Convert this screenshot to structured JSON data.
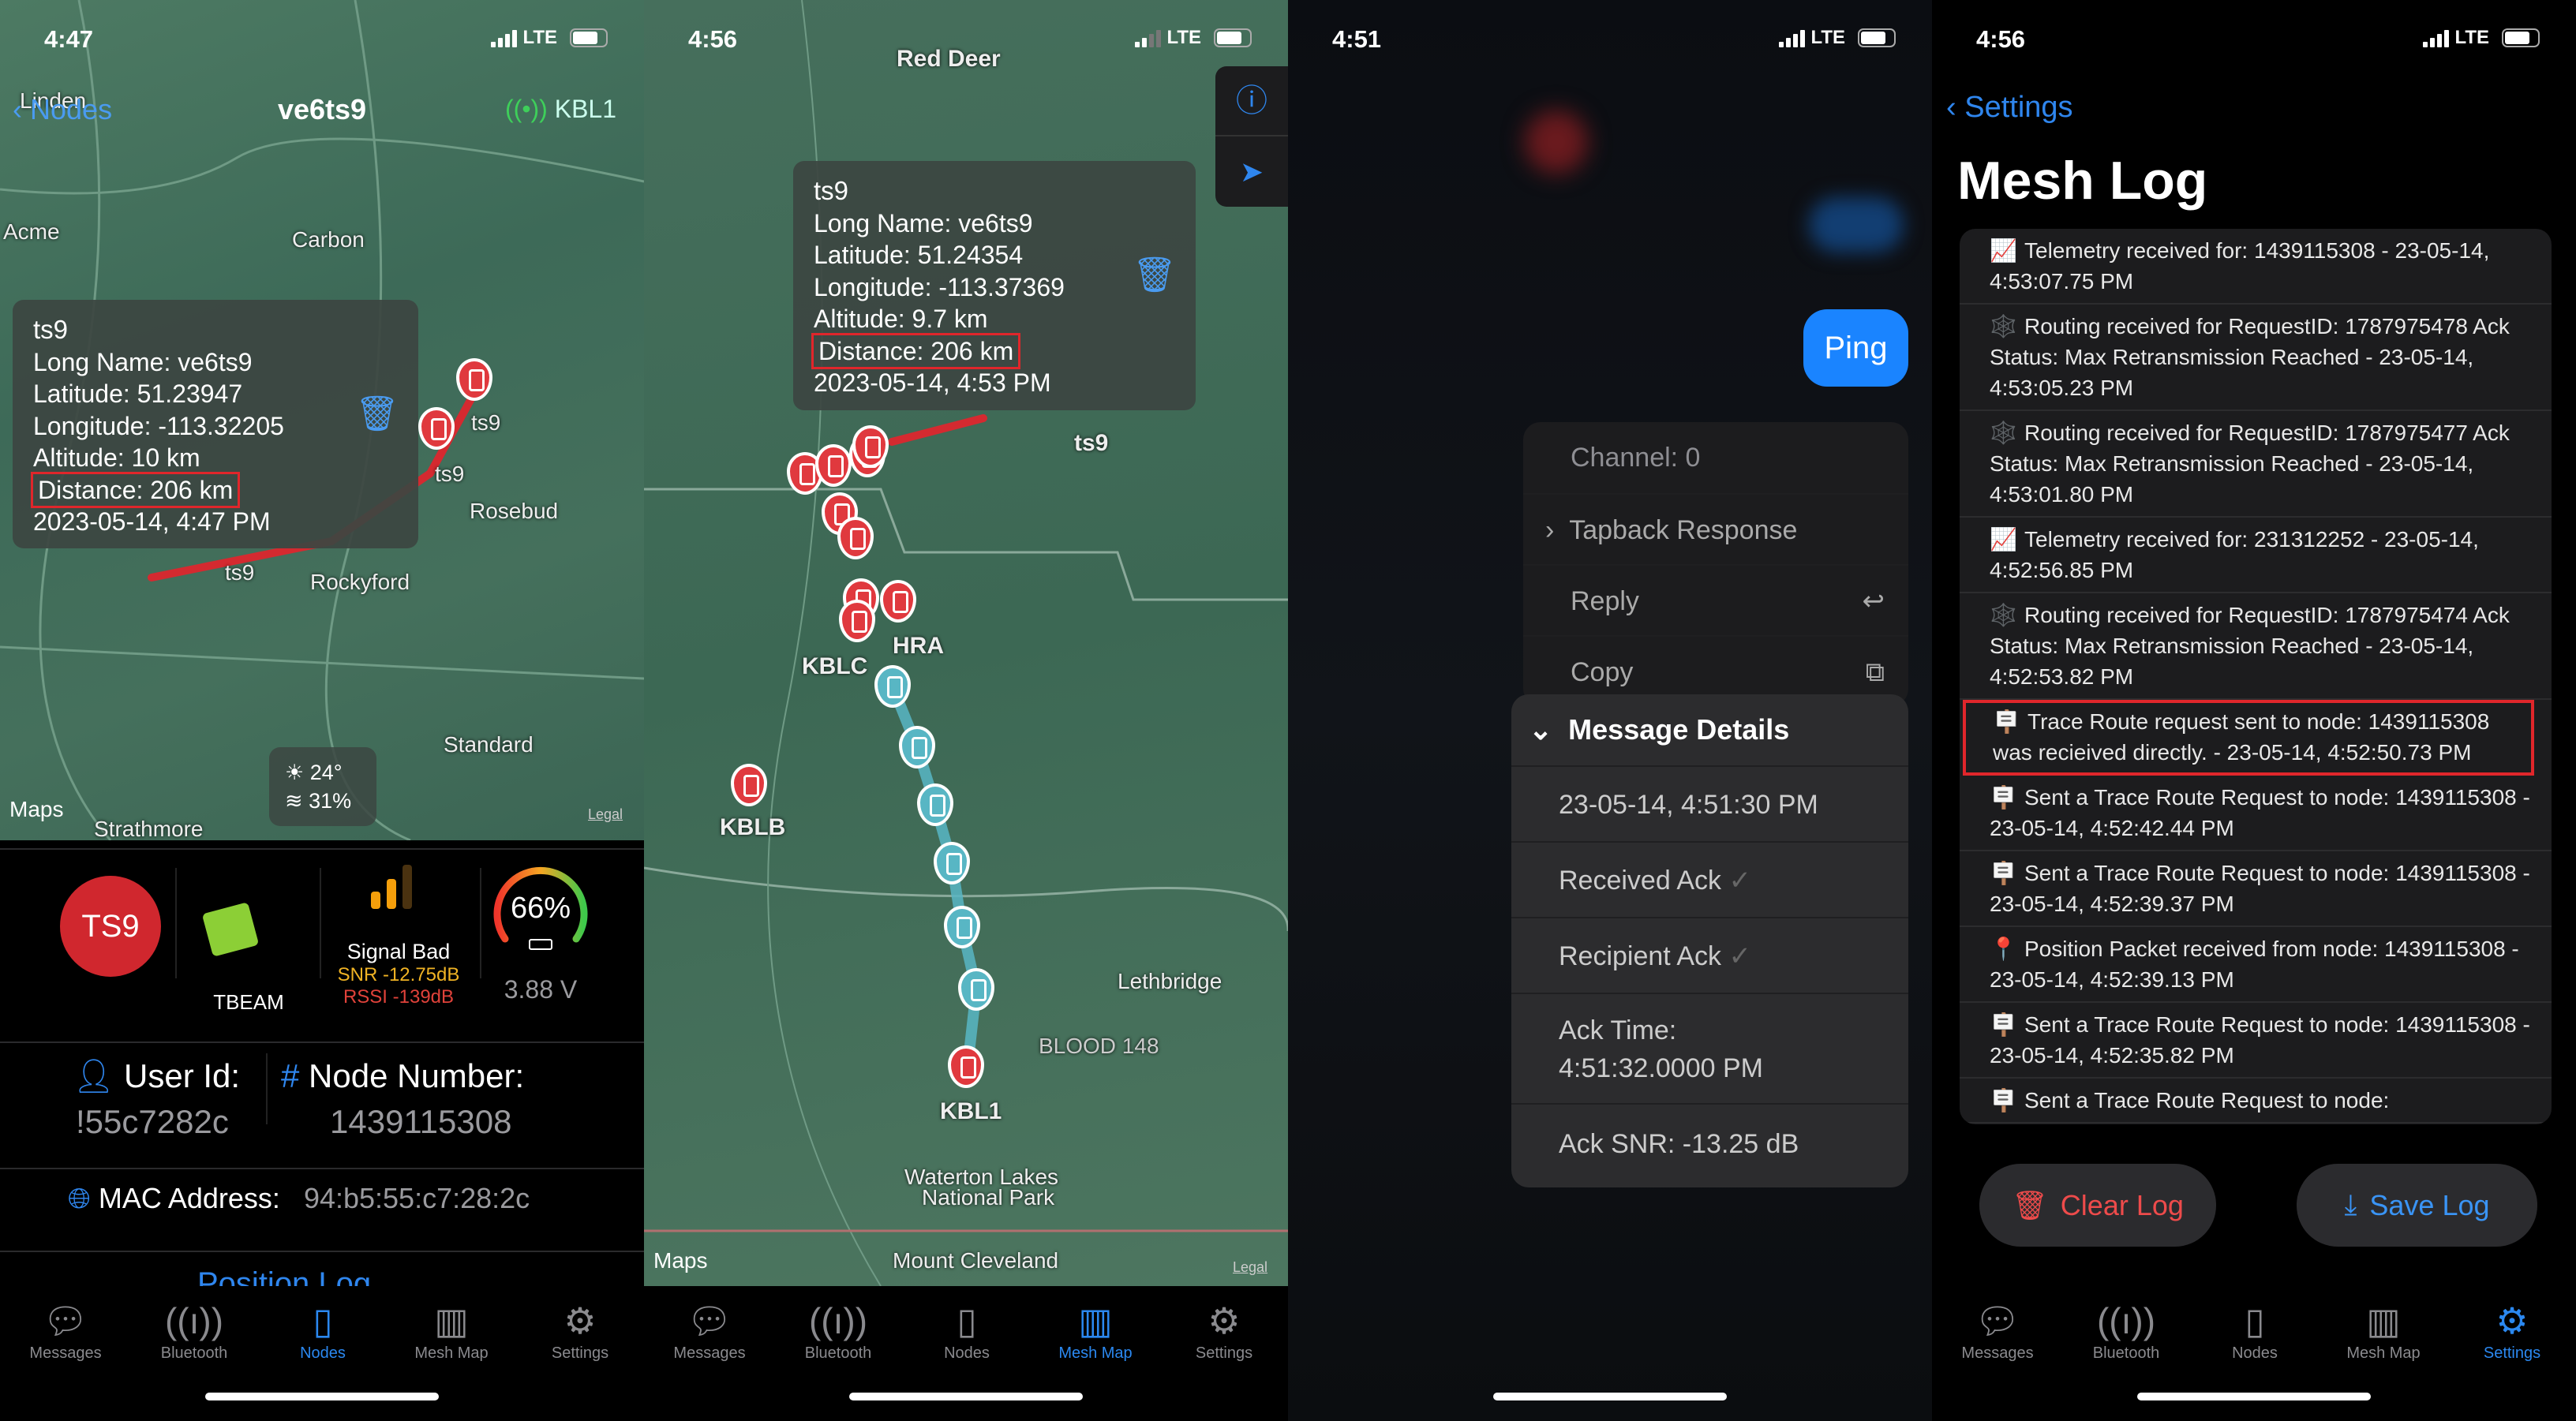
{
  "tab_bar": {
    "items": [
      {
        "label": "Messages",
        "icon": "speech-bubble-icon"
      },
      {
        "label": "Bluetooth",
        "icon": "antenna-icon"
      },
      {
        "label": "Nodes",
        "icon": "device-icon"
      },
      {
        "label": "Mesh Map",
        "icon": "map-icon"
      },
      {
        "label": "Settings",
        "icon": "gear-icon"
      }
    ]
  },
  "colors": {
    "accent": "#2b88f0",
    "node_red": "#d0272e",
    "highlight": "#e0262b",
    "snr": "#f0b324",
    "rssi": "#e0423a"
  },
  "nodes_panel": {
    "status_time": "4:47",
    "network": "LTE",
    "nav": {
      "back": "Nodes",
      "title": "ve6ts9",
      "right": "KBL1"
    },
    "map_labels": [
      "Linden",
      "Acme",
      "Carbon",
      "ts9",
      "ts9",
      "Rosebud",
      "ts9",
      "Rockyford",
      "Standard",
      "Strathmore"
    ],
    "weather": {
      "temp": "24°",
      "humidity": "31%"
    },
    "maps_logo": "Maps",
    "legal": "Legal",
    "popup": {
      "title": "ts9",
      "long_name": "Long Name: ve6ts9",
      "latitude": "Latitude: 51.23947",
      "longitude": "Longitude: -113.32205",
      "altitude": "Altitude: 10 km",
      "distance": "Distance: 206 km",
      "time": "2023-05-14, 4:47 PM"
    },
    "node": {
      "short": "TS9",
      "hardware": "TBEAM",
      "signal": "Signal Bad",
      "snr": "SNR -12.75dB",
      "rssi": "RSSI -139dB",
      "battery_percent": "66%",
      "battery_level": 66,
      "voltage": "3.88 V"
    },
    "user_id_label": "User Id:",
    "user_id": "!55c7282c",
    "node_number_label": "Node Number:",
    "node_number": "1439115308",
    "mac_label": "MAC Address:",
    "mac": "94:b5:55:c7:28:2c",
    "position_log": "Position Log",
    "active_tab": 2
  },
  "map_panel": {
    "status_time": "4:56",
    "network": "LTE",
    "map_labels": [
      "Red Deer",
      "ts9",
      "HRA",
      "KBLC",
      "KBLB",
      "Lethbridge",
      "BLOOD 148",
      "KBL1",
      "Waterton Lakes",
      "National Park",
      "Mount Cleveland"
    ],
    "maps_logo": "Maps",
    "legal": "Legal",
    "popup": {
      "title": "ts9",
      "long_name": "Long Name: ve6ts9",
      "latitude": "Latitude: 51.24354",
      "longitude": "Longitude: -113.37369",
      "altitude": "Altitude: 9.7 km",
      "distance": "Distance: 206 km",
      "time": "2023-05-14, 4:53 PM"
    },
    "active_tab": 3
  },
  "message_panel": {
    "status_time": "4:51",
    "network": "LTE",
    "bubble": "Ping",
    "menu": {
      "channel": "Channel: 0",
      "tapback": "Tapback Response",
      "reply": "Reply",
      "copy": "Copy"
    },
    "details": {
      "header": "Message Details",
      "time": "23-05-14, 4:51:30 PM",
      "received_ack": "Received Ack",
      "recipient_ack": "Recipient Ack",
      "ack_time": "Ack Time:",
      "ack_time_value": "4:51:32.0000  PM",
      "ack_snr": "Ack SNR: -13.25 dB"
    }
  },
  "log_panel": {
    "status_time": "4:56",
    "network": "LTE",
    "back": "Settings",
    "title": "Mesh Log",
    "entries": [
      {
        "icon": "📈",
        "text": "Telemetry received for: 1439115308 - 23-05-14, 4:53:07.75 PM"
      },
      {
        "icon": "🕸️",
        "text": "Routing received for RequestID: 1787975478 Ack Status: Max Retransmission Reached - 23-05-14, 4:53:05.23 PM"
      },
      {
        "icon": "🕸️",
        "text": "Routing received for RequestID: 1787975477 Ack Status: Max Retransmission Reached - 23-05-14, 4:53:01.80 PM"
      },
      {
        "icon": "📈",
        "text": "Telemetry received for: 231312252 - 23-05-14, 4:52:56.85 PM"
      },
      {
        "icon": "🕸️",
        "text": "Routing received for RequestID: 1787975474 Ack Status: Max Retransmission Reached - 23-05-14, 4:52:53.82 PM"
      },
      {
        "icon": "🪧",
        "text": "Trace Route request sent to node: 1439115308 was recieived directly. - 23-05-14, 4:52:50.73 PM",
        "highlighted": true
      },
      {
        "icon": "🪧",
        "text": "Sent a Trace Route Request to node: 1439115308 - 23-05-14, 4:52:42.44 PM"
      },
      {
        "icon": "🪧",
        "text": "Sent a Trace Route Request to node: 1439115308 - 23-05-14, 4:52:39.37 PM"
      },
      {
        "icon": "📍",
        "text": "Position Packet received from node: 1439115308 - 23-05-14, 4:52:39.13 PM"
      },
      {
        "icon": "🪧",
        "text": "Sent a Trace Route Request to node: 1439115308 - 23-05-14, 4:52:35.82 PM"
      },
      {
        "icon": "🪧",
        "text": "Sent a Trace Route Request to node:"
      }
    ],
    "clear": "Clear Log",
    "save": "Save Log",
    "active_tab": 4
  }
}
